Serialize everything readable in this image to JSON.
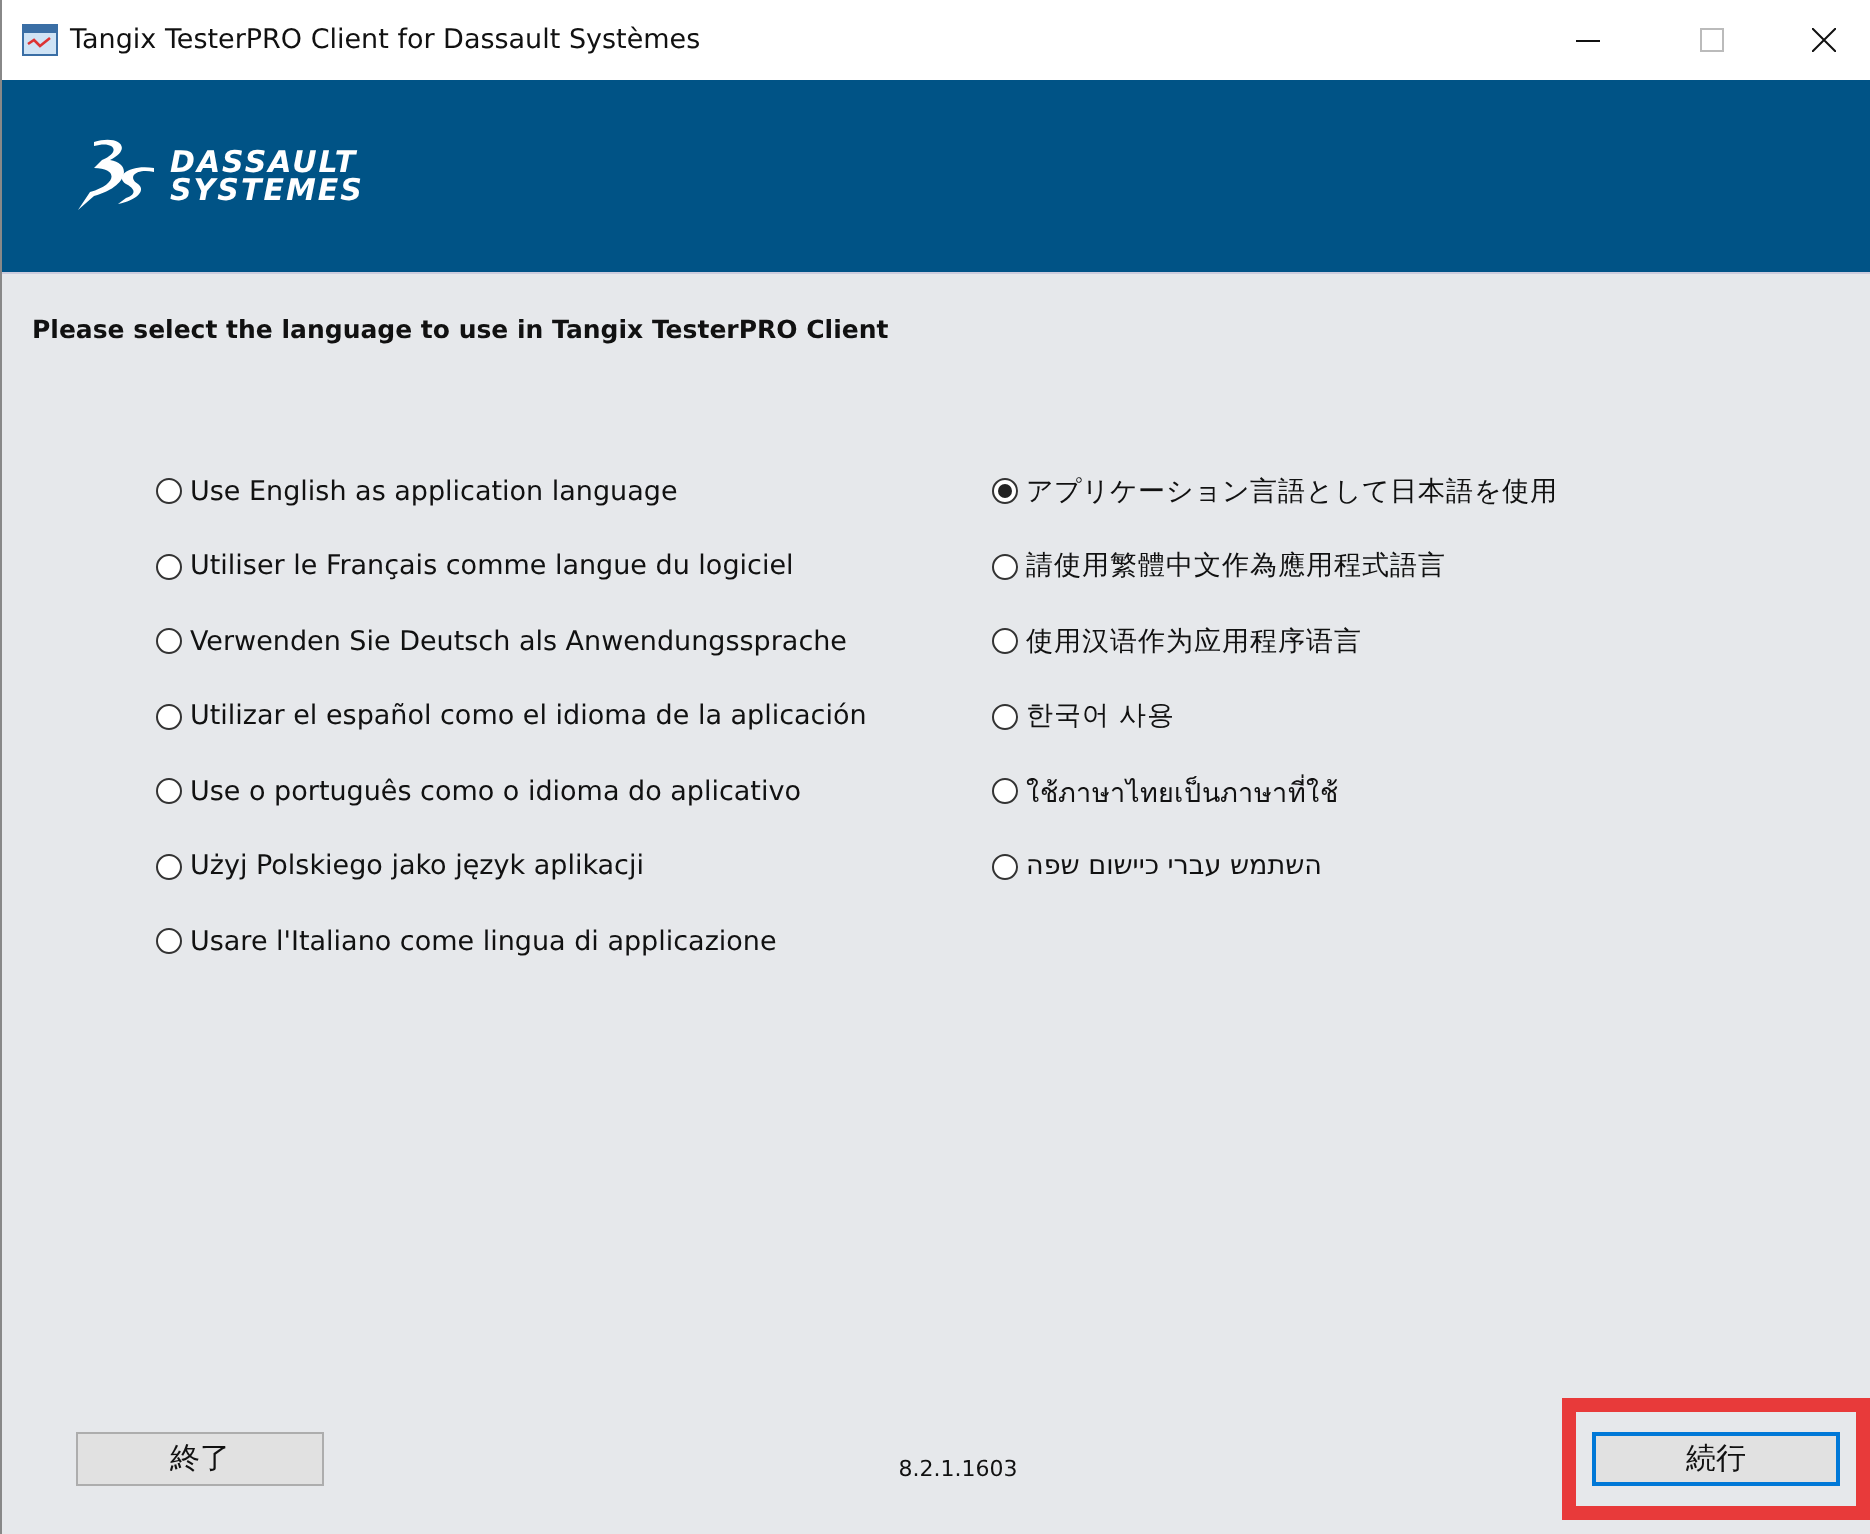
{
  "window": {
    "title": "Tangix TesterPRO Client for Dassault Systèmes"
  },
  "banner": {
    "logo_line_1": "DASSAULT",
    "logo_line_2": "SYSTEMES"
  },
  "prompt": "Please select the language to use in Tangix TesterPRO Client",
  "languages_left": [
    {
      "label": "Use English as application language",
      "selected": false
    },
    {
      "label": "Utiliser le Français comme langue du logiciel",
      "selected": false
    },
    {
      "label": "Verwenden Sie Deutsch als Anwendungssprache",
      "selected": false
    },
    {
      "label": "Utilizar el español como el idioma de la aplicación",
      "selected": false
    },
    {
      "label": "Use o português como o idioma do aplicativo",
      "selected": false
    },
    {
      "label": "Użyj Polskiego jako język aplikacji",
      "selected": false
    },
    {
      "label": "Usare l'Italiano come lingua di applicazione",
      "selected": false
    }
  ],
  "languages_right": [
    {
      "label": "アプリケーション言語として日本語を使用",
      "selected": true
    },
    {
      "label": "請使用繁體中文作為應用程式語言",
      "selected": false
    },
    {
      "label": "使用汉语作为应用程序语言",
      "selected": false
    },
    {
      "label": "한국어 사용",
      "selected": false
    },
    {
      "label": "ใช้ภาษาไทยเป็นภาษาที่ใช้",
      "selected": false
    },
    {
      "label": "השתמש עברי כיישום שפה",
      "selected": false
    }
  ],
  "footer": {
    "exit_button": {
      "label": "終了",
      "highlighted": false
    },
    "version": "8.2.1.1603",
    "continue_button": {
      "label": "続行",
      "highlighted": true
    }
  }
}
